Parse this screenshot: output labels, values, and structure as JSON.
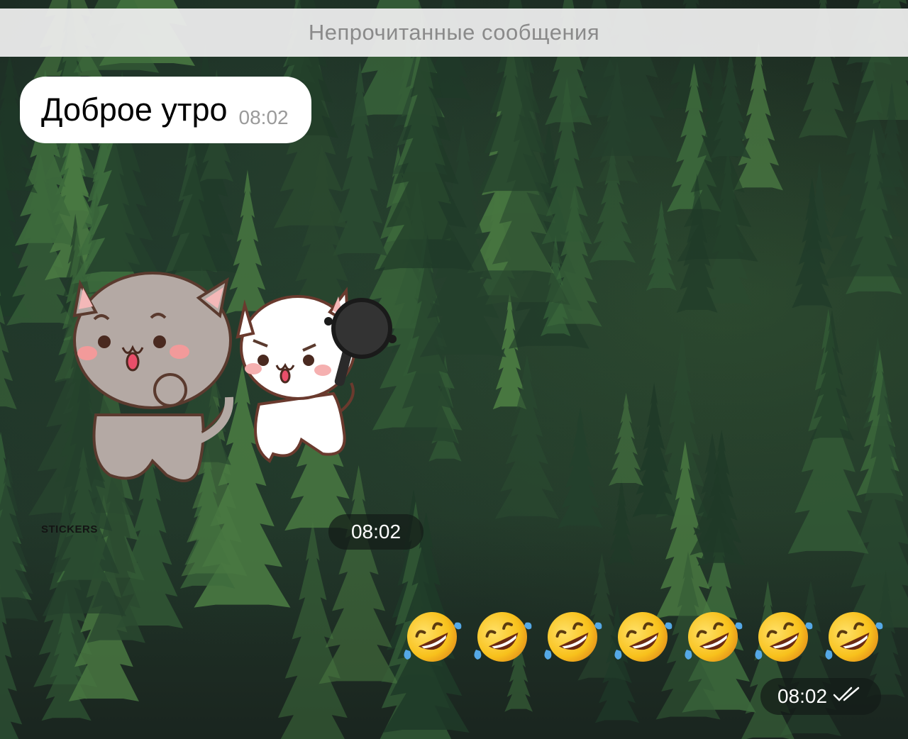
{
  "unread_divider": "Непрочитанные сообщения",
  "incoming_message": {
    "text": "Доброе утро",
    "time": "08:02"
  },
  "sticker_message": {
    "pack_watermark": "STICKERS",
    "time": "08:02"
  },
  "outgoing_message": {
    "emojis": [
      "🤣",
      "🤣",
      "🤣",
      "🤣",
      "🤣",
      "🤣",
      "🤣"
    ],
    "time": "08:02",
    "status": "read"
  },
  "colors": {
    "bubble_incoming": "#ffffff",
    "divider_bg": "#ececec",
    "divider_text": "#8a8a8a",
    "time_pill_bg": "#141c18"
  }
}
